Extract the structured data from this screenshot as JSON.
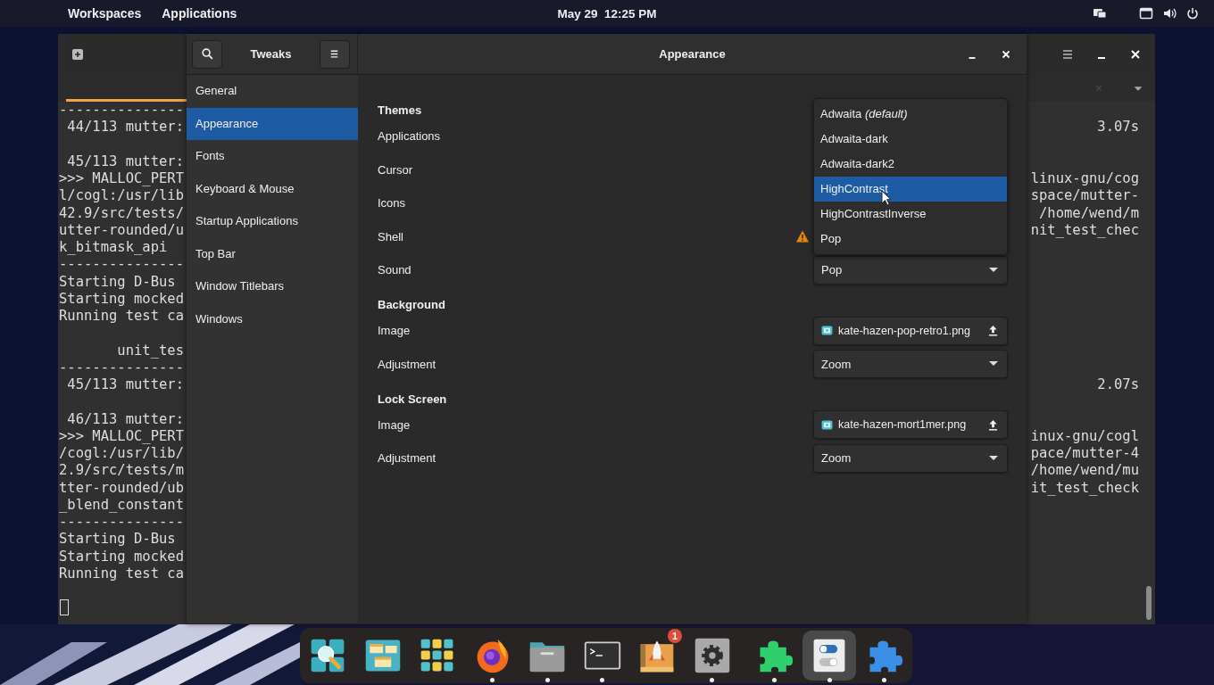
{
  "top_bar": {
    "menus": [
      "Workspaces",
      "Applications"
    ],
    "clock": "May 29  12:25 PM"
  },
  "terminal": {
    "blocks": [
      {
        "lines": [
          {
            "left": "---------------"
          },
          {
            "left": " 44/113 mutter:",
            "right": "3.07s"
          }
        ]
      },
      {
        "lines": [
          {
            "left": " 45/113 mutter:"
          },
          {
            "left": ">>> MALLOC_PERT",
            "right": "linux-gnu/cog"
          },
          {
            "left": "l/cogl:/usr/lib",
            "right": "space/mutter-"
          },
          {
            "left": "42.9/src/tests/",
            "right": "/home/wend/m"
          },
          {
            "left": "utter-rounded/u",
            "right": "nit_test_chec"
          },
          {
            "left": "k_bitmask_api"
          },
          {
            "left": "---------------"
          },
          {
            "left": "Starting D-Bus"
          },
          {
            "left": "Starting mocked"
          },
          {
            "left": "Running test ca"
          }
        ]
      },
      {
        "lines": [
          {
            "left": "       unit_tes"
          },
          {
            "left": "---------------"
          },
          {
            "left": " 45/113 mutter:",
            "right": "2.07s"
          }
        ]
      },
      {
        "lines": [
          {
            "left": " 46/113 mutter:"
          },
          {
            "left": ">>> MALLOC_PERT",
            "right": "inux-gnu/cogl"
          },
          {
            "left": "/cogl:/usr/lib/",
            "right": "pace/mutter-4"
          },
          {
            "left": "2.9/src/tests/m",
            "right": "/home/wend/mu"
          },
          {
            "left": "tter-rounded/ub",
            "right": "it_test_check"
          },
          {
            "left": "_blend_constant"
          },
          {
            "left": "---------------"
          },
          {
            "left": "Starting D-Bus"
          },
          {
            "left": "Starting mocked"
          },
          {
            "left": "Running test ca"
          }
        ]
      }
    ]
  },
  "tweaks": {
    "title": "Tweaks",
    "page_title": "Appearance",
    "sidebar": [
      {
        "label": "General",
        "selected": false
      },
      {
        "label": "Appearance",
        "selected": true
      },
      {
        "label": "Fonts",
        "selected": false
      },
      {
        "label": "Keyboard & Mouse",
        "selected": false
      },
      {
        "label": "Startup Applications",
        "selected": false
      },
      {
        "label": "Top Bar",
        "selected": false
      },
      {
        "label": "Window Titlebars",
        "selected": false
      },
      {
        "label": "Windows",
        "selected": false
      }
    ],
    "sections": [
      {
        "heading": "Themes",
        "rows": [
          {
            "label": "Applications",
            "warning": false
          },
          {
            "label": "Cursor",
            "warning": false
          },
          {
            "label": "Icons",
            "warning": false
          },
          {
            "label": "Shell",
            "warning": true
          },
          {
            "label": "Sound",
            "warning": false,
            "kind": "combo",
            "value": "Pop"
          }
        ]
      },
      {
        "heading": "Background",
        "rows": [
          {
            "label": "Image",
            "warning": false,
            "kind": "file",
            "value": "kate-hazen-pop-retro1.png"
          },
          {
            "label": "Adjustment",
            "warning": false,
            "kind": "combo",
            "value": "Zoom"
          }
        ]
      },
      {
        "heading": "Lock Screen",
        "rows": [
          {
            "label": "Image",
            "warning": false,
            "kind": "file",
            "value": "kate-hazen-mort1mer.png"
          },
          {
            "label": "Adjustment",
            "warning": false,
            "kind": "combo",
            "value": "Zoom"
          }
        ]
      }
    ],
    "popup": {
      "options": [
        {
          "label": "Adwaita *(default)*",
          "selected": false
        },
        {
          "label": "Adwaita-dark",
          "selected": false
        },
        {
          "label": "Adwaita-dark2",
          "selected": false
        },
        {
          "label": "HighContrast",
          "selected": true
        },
        {
          "label": "HighContrastInverse",
          "selected": false
        },
        {
          "label": "Pop",
          "selected": false
        }
      ]
    }
  },
  "dock": {
    "items": [
      {
        "kind": "search",
        "running": false,
        "selected": false
      },
      {
        "kind": "windows",
        "running": false,
        "selected": false
      },
      {
        "kind": "grid",
        "running": false,
        "selected": false
      },
      {
        "kind": "browser",
        "running": true,
        "selected": false
      },
      {
        "kind": "folder",
        "running": true,
        "selected": false
      },
      {
        "kind": "terminal",
        "running": true,
        "selected": false
      },
      {
        "kind": "rocket",
        "running": false,
        "selected": false,
        "badge": "1"
      },
      {
        "kind": "gear",
        "running": true,
        "selected": false
      },
      {
        "kind": "puzzle",
        "running": true,
        "selected": false,
        "separated": true
      },
      {
        "kind": "toggles",
        "running": true,
        "selected": true
      },
      {
        "kind": "puzzle-blue",
        "running": true,
        "selected": false
      }
    ]
  }
}
